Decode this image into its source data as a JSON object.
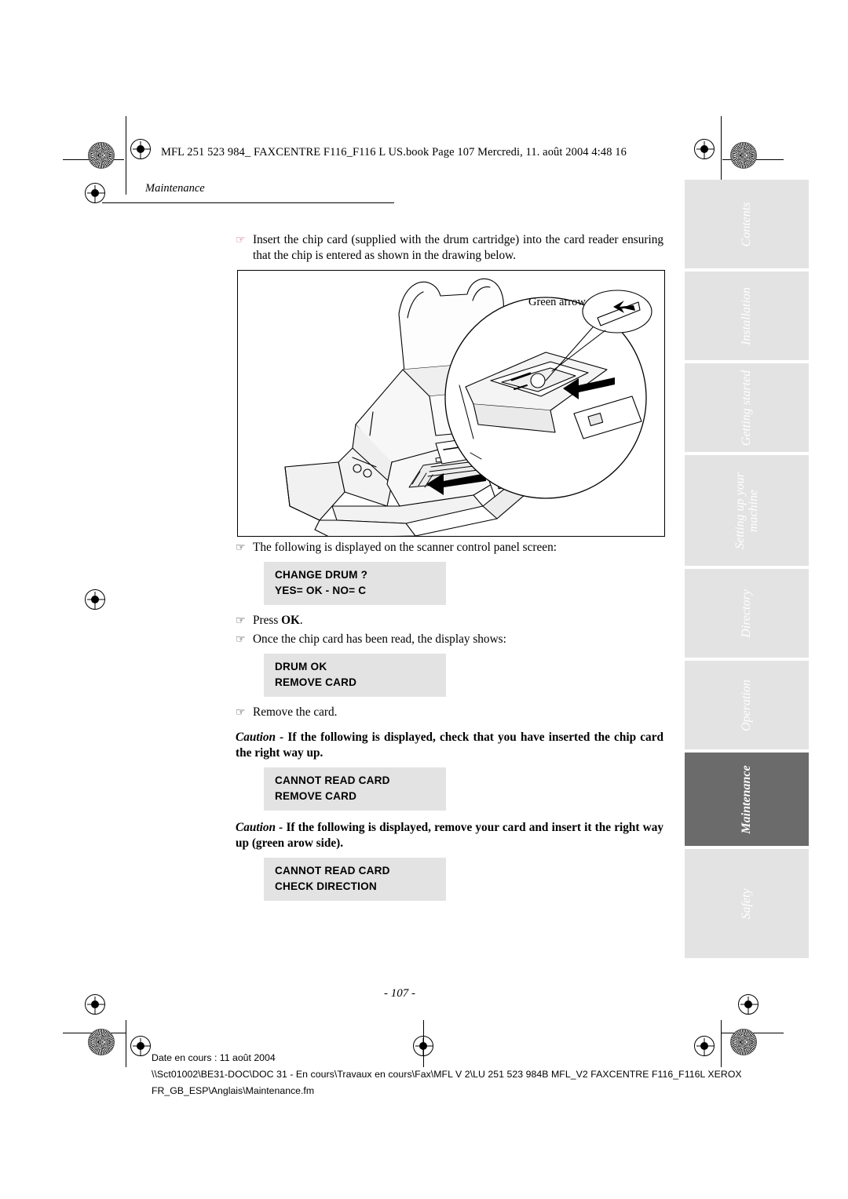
{
  "header": {
    "book_line": "MFL 251 523 984_ FAXCENTRE F116_F116 L US.book  Page 107  Mercredi, 11. août 2004  4:48 16",
    "chapter": "Maintenance"
  },
  "content": {
    "step1": "Insert the chip card (supplied with the drum cartridge) into the card reader ensuring that the chip is entered as shown in the drawing below.",
    "figure_label": "Green arrow",
    "step2": "The following is displayed on the scanner control panel screen:",
    "lcd1_line1": "CHANGE DRUM ?",
    "lcd1_line2": "YES= OK - NO= C",
    "step3_pre": "Press ",
    "step3_bold": "OK",
    "step3_post": ".",
    "step4": "Once the chip card has been read, the display shows:",
    "lcd2_line1": "DRUM OK",
    "lcd2_line2": "REMOVE CARD",
    "step5": "Remove the card.",
    "caution1_word": "Caution - ",
    "caution1_text": "If the following is displayed, check that you have inserted the chip card the right way up.",
    "lcd3_line1": "CANNOT READ CARD",
    "lcd3_line2": "REMOVE CARD",
    "caution2_word": "Caution - ",
    "caution2_text": "If the following is displayed, remove your card and insert it the right way up (green arow side).",
    "lcd4_line1": "CANNOT READ CARD",
    "lcd4_line2": "CHECK DIRECTION"
  },
  "page_number": "- 107 -",
  "tabs": [
    {
      "label": "Contents",
      "current": false
    },
    {
      "label": "Installation",
      "current": false
    },
    {
      "label": "Getting started",
      "current": false
    },
    {
      "label": "Setting up your\nmachine",
      "current": false
    },
    {
      "label": "Directory",
      "current": false
    },
    {
      "label": "Operation",
      "current": false
    },
    {
      "label": "Maintenance",
      "current": true
    },
    {
      "label": "Safety",
      "current": false
    }
  ],
  "footer": {
    "line1": "Date en cours : 11 août 2004",
    "line2": "\\\\Sct01002\\BE31-DOC\\DOC 31 - En cours\\Travaux en cours\\Fax\\MFL V 2\\LU 251 523 984B MFL_V2 FAXCENTRE F116_F116L XEROX",
    "line3": "FR_GB_ESP\\Anglais\\Maintenance.fm"
  }
}
